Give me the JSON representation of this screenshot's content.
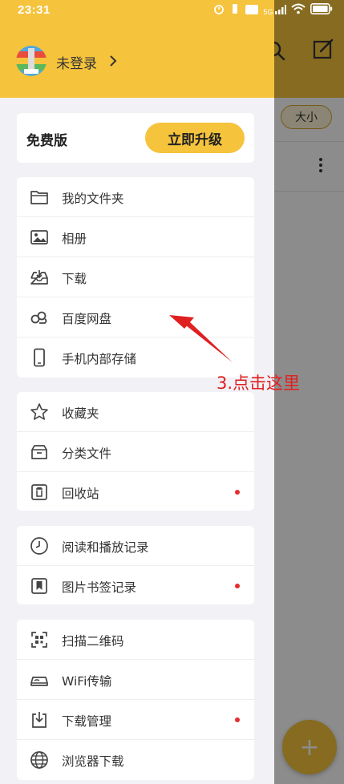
{
  "status_bar": {
    "time": "23:31",
    "network": "5G"
  },
  "background_app": {
    "size_button": "大小",
    "fab_label": "+"
  },
  "drawer": {
    "user": {
      "login_text": "未登录"
    },
    "vip": {
      "label": "免费版",
      "upgrade_button": "立即升级"
    },
    "groups": [
      {
        "items": [
          {
            "label": "我的文件夹",
            "icon": "folder-icon",
            "dot": false
          },
          {
            "label": "相册",
            "icon": "image-icon",
            "dot": false
          },
          {
            "label": "下载",
            "icon": "download-tray-icon",
            "dot": false
          },
          {
            "label": "百度网盘",
            "icon": "baidu-netdisk-icon",
            "dot": false
          },
          {
            "label": "手机内部存储",
            "icon": "phone-icon",
            "dot": false
          }
        ]
      },
      {
        "items": [
          {
            "label": "收藏夹",
            "icon": "star-icon",
            "dot": false
          },
          {
            "label": "分类文件",
            "icon": "archive-box-icon",
            "dot": false
          },
          {
            "label": "回收站",
            "icon": "trash-icon",
            "dot": true
          }
        ]
      },
      {
        "items": [
          {
            "label": "阅读和播放记录",
            "icon": "clock-icon",
            "dot": false
          },
          {
            "label": "图片书签记录",
            "icon": "bookmark-icon",
            "dot": true
          }
        ]
      },
      {
        "items": [
          {
            "label": "扫描二维码",
            "icon": "qr-scan-icon",
            "dot": false
          },
          {
            "label": "WiFi传输",
            "icon": "wifi-transfer-icon",
            "dot": false
          },
          {
            "label": "下载管理",
            "icon": "download-manager-icon",
            "dot": true
          },
          {
            "label": "浏览器下载",
            "icon": "globe-icon",
            "dot": false
          }
        ]
      }
    ]
  },
  "annotation": {
    "text": "3.点击这里"
  },
  "colors": {
    "accent": "#f5c33c",
    "red_dot": "#e52d2d",
    "annotation": "#e02020"
  }
}
